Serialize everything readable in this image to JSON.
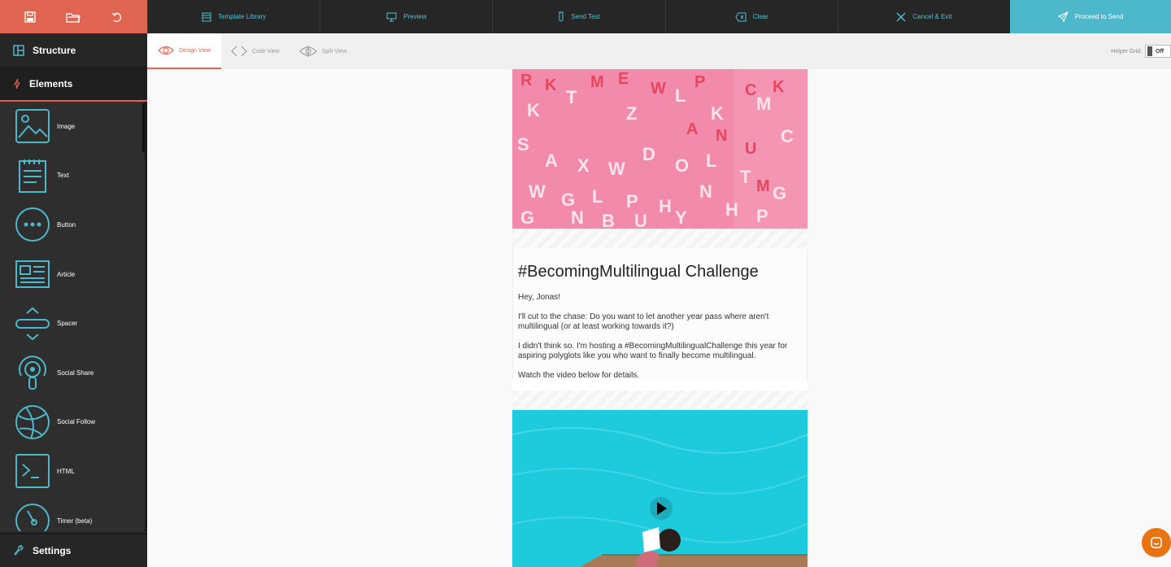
{
  "topbar": {
    "tools": [
      {
        "label": "Template Library",
        "icon": "template-icon"
      },
      {
        "label": "Preview",
        "icon": "monitor-icon"
      },
      {
        "label": "Send Test",
        "icon": "test-tube-icon"
      },
      {
        "label": "Clear",
        "icon": "backspace-icon"
      },
      {
        "label": "Cancel & Exit",
        "icon": "close-icon"
      }
    ],
    "send_label": "Proceed to Send"
  },
  "sidebar": {
    "structure_label": "Structure",
    "elements_label": "Elements",
    "settings_label": "Settings",
    "items": [
      {
        "label": "Image",
        "icon": "image-icon"
      },
      {
        "label": "Text",
        "icon": "text-icon"
      },
      {
        "label": "Button",
        "icon": "button-icon"
      },
      {
        "label": "Article",
        "icon": "article-icon"
      },
      {
        "label": "Spacer",
        "icon": "spacer-icon"
      },
      {
        "label": "Social Share",
        "icon": "social-share-icon"
      },
      {
        "label": "Social Follow",
        "icon": "globe-icon"
      },
      {
        "label": "HTML",
        "icon": "terminal-icon"
      },
      {
        "label": "Timer (beta)",
        "icon": "timer-icon"
      }
    ]
  },
  "views": {
    "design": "Design View",
    "code": "Code View",
    "split": "Split View"
  },
  "helper_grid": {
    "label": "Helper Grid:",
    "state": "Off"
  },
  "email": {
    "headline": "#BecomingMultilingual Challenge",
    "paragraphs": [
      "Hey, Jonas!",
      "I'll cut to the chase: Do you want to let another year pass where aren't multilingual (or at least working towards it?)",
      "I didn't think so. I'm hosting a #BecomingMultilingualChallenge this year for aspiring polyglots like you who want to finally become multilingual.",
      "Watch the video below for details."
    ]
  },
  "colors": {
    "accent": "#e06452",
    "teal": "#4db8c9",
    "dark": "#262626"
  }
}
